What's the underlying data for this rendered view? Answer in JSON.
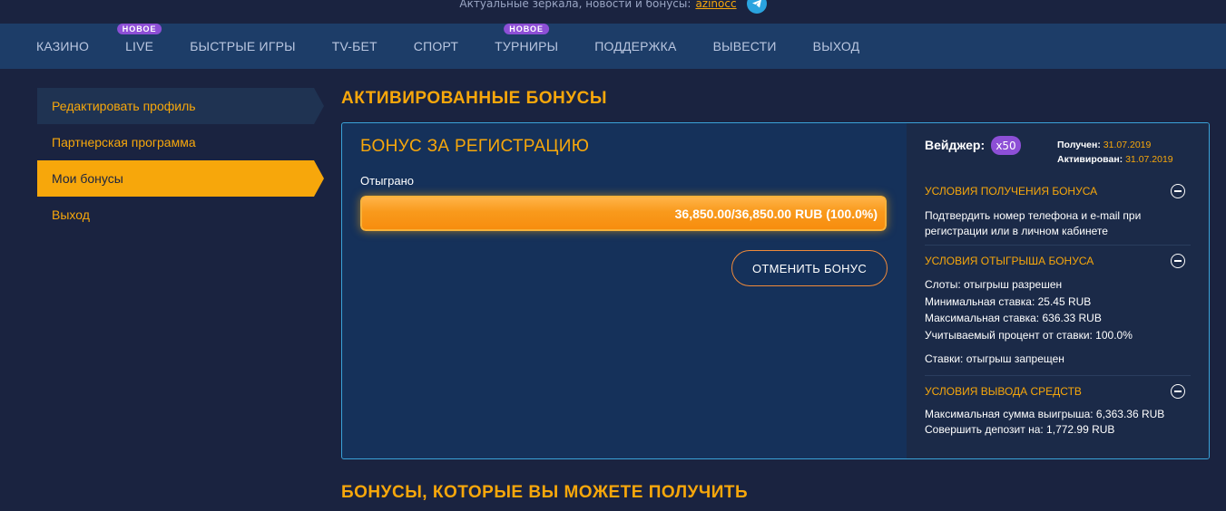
{
  "topstrip": {
    "text": "Актуальные зеркала, новости и бонусы:",
    "link": "azinocc"
  },
  "nav": [
    {
      "label": "КАЗИНО",
      "badge": ""
    },
    {
      "label": "LIVE",
      "badge": "НОВОЕ"
    },
    {
      "label": "БЫСТРЫЕ ИГРЫ",
      "badge": ""
    },
    {
      "label": "TV-БЕТ",
      "badge": ""
    },
    {
      "label": "СПОРТ",
      "badge": ""
    },
    {
      "label": "ТУРНИРЫ",
      "badge": "НОВОЕ"
    },
    {
      "label": "ПОДДЕРЖКА",
      "badge": ""
    },
    {
      "label": "ВЫВЕСТИ",
      "badge": ""
    },
    {
      "label": "ВЫХОД",
      "badge": ""
    }
  ],
  "sidebar": {
    "items": [
      {
        "label": "Редактировать профиль"
      },
      {
        "label": "Партнерская программа"
      },
      {
        "label": "Мои бонусы"
      },
      {
        "label": "Выход"
      }
    ]
  },
  "activated": {
    "title": "АКТИВИРОВАННЫЕ БОНУСЫ",
    "bonus_title": "БОНУС ЗА РЕГИСТРАЦИЮ",
    "played_label": "Отыграно",
    "progress_text": "36,850.00/36,850.00 RUB (100.0%)",
    "progress_fraction": 1.0,
    "cancel_label": "ОТМЕНИТЬ БОНУС",
    "wager_label": "Вейджер:",
    "wager_value": "x50",
    "received_label": "Получен:",
    "received_date": "31.07.2019",
    "activated_label": "Активирован:",
    "activated_date": "31.07.2019",
    "conditions": {
      "receive": {
        "title": "УСЛОВИЯ ПОЛУЧЕНИЯ БОНУСА",
        "line1": "Подтвердить номер телефона и e-mail при",
        "line2": "регистрации или в личном кабинете"
      },
      "wagering": {
        "title": "УСЛОВИЯ ОТЫГРЫША БОНУСА",
        "slots": "Слоты: отыгрыш разрешен",
        "min_bet": "Минимальная ставка: 25.45 RUB",
        "max_bet": "Максимальная ставка: 636.33 RUB",
        "percent": "Учитываемый процент от ставки: 100.0%",
        "bets": "Ставки: отыгрыш запрещен"
      },
      "withdraw": {
        "title": "УСЛОВИЯ ВЫВОДА СРЕДСТВ",
        "max_win": "Максимальная сумма выигрыша: 6,363.36 RUB",
        "deposit": "Совершить депозит на: 1,772.99 RUB"
      }
    }
  },
  "available": {
    "title": "БОНУСЫ, КОТОРЫЕ ВЫ МОЖЕТЕ ПОЛУЧИТЬ"
  },
  "colors": {
    "accent": "#f7a70b",
    "nav_bg": "#1d3d68",
    "page_bg": "#1a2340",
    "badge": "#8d4fd6",
    "card_border": "#3aa2d8"
  }
}
